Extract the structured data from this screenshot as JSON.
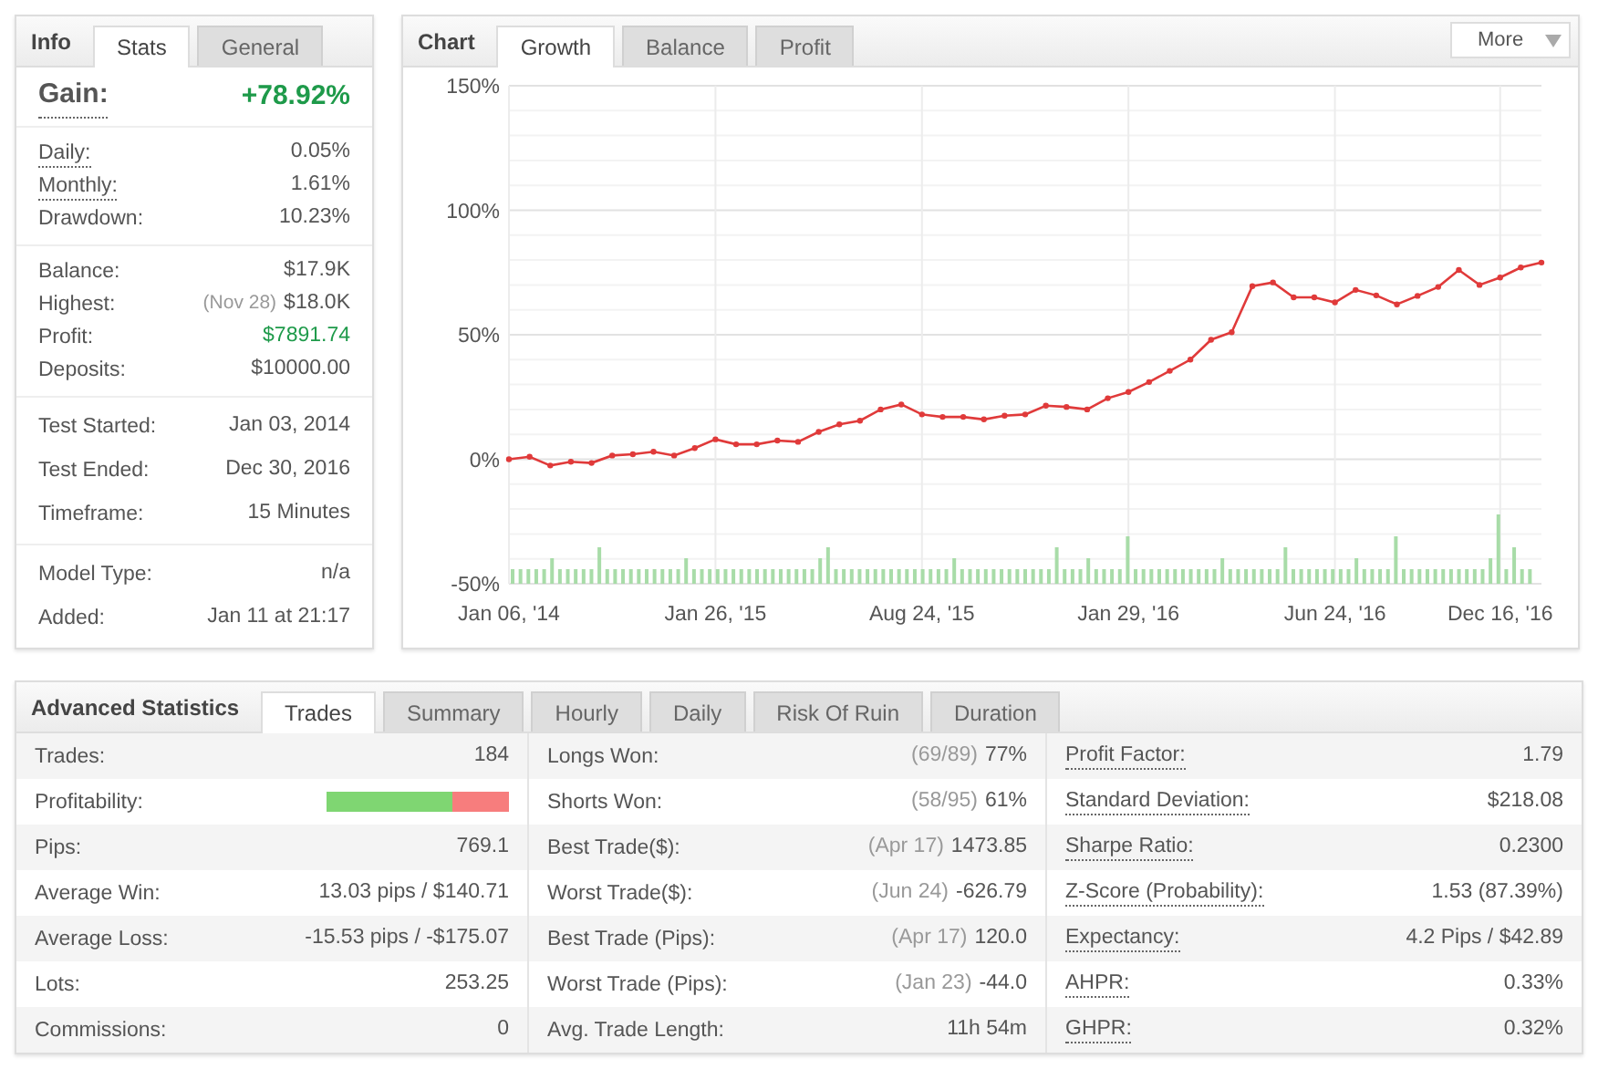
{
  "info": {
    "title": "Info",
    "tabs": [
      {
        "label": "Stats",
        "selected": true
      },
      {
        "label": "General",
        "selected": false
      }
    ],
    "gain": {
      "label": "Gain:",
      "value": "+78.92%",
      "positive": true,
      "has_tooltip": true
    },
    "groups": [
      [
        {
          "label": "Daily:",
          "value": "0.05%",
          "positive": false,
          "has_tooltip": true
        },
        {
          "label": "Monthly:",
          "value": "1.61%",
          "positive": false,
          "has_tooltip": true
        },
        {
          "label": "Drawdown:",
          "value": "10.23%",
          "positive": false,
          "has_tooltip": false
        }
      ],
      [
        {
          "label": "Balance:",
          "value": "$17.9K",
          "positive": false,
          "has_tooltip": false
        },
        {
          "label": "Highest:",
          "note": "(Nov 28)",
          "value": "$18.0K",
          "positive": false,
          "has_tooltip": false
        },
        {
          "label": "Profit:",
          "value": "$7891.74",
          "positive": true,
          "has_tooltip": false
        },
        {
          "label": "Deposits:",
          "value": "$10000.00",
          "positive": false,
          "has_tooltip": false
        }
      ],
      [
        {
          "label": "Test Started:",
          "value": "Jan 03, 2014",
          "positive": false,
          "has_tooltip": false
        },
        {
          "label": "Test Ended:",
          "value": "Dec 30, 2016",
          "positive": false,
          "has_tooltip": false
        },
        {
          "label": "Timeframe:",
          "value": "15 Minutes",
          "positive": false,
          "has_tooltip": false
        }
      ],
      [
        {
          "label": "Model Type:",
          "value": "n/a",
          "positive": false,
          "has_tooltip": false
        },
        {
          "label": "Added:",
          "value": "Jan 11 at 21:17",
          "positive": false,
          "has_tooltip": false
        }
      ]
    ]
  },
  "chart": {
    "title": "Chart",
    "tabs": [
      {
        "label": "Growth",
        "selected": true
      },
      {
        "label": "Balance",
        "selected": false
      },
      {
        "label": "Profit",
        "selected": false
      }
    ],
    "more_button": "More",
    "chart_data": {
      "type": "line",
      "ylim": [
        -50,
        150
      ],
      "yticks": [
        {
          "value": -50,
          "label": "-50%"
        },
        {
          "value": 0,
          "label": "0%"
        },
        {
          "value": 50,
          "label": "50%"
        },
        {
          "value": 100,
          "label": "100%"
        },
        {
          "value": 150,
          "label": "150%"
        }
      ],
      "grid": true,
      "categories": [
        "Jan 06, '14",
        null,
        null,
        null,
        null,
        null,
        null,
        null,
        null,
        null,
        "Jan 26, '15",
        null,
        null,
        null,
        null,
        null,
        null,
        null,
        null,
        null,
        "Aug 24, '15",
        null,
        null,
        null,
        null,
        null,
        null,
        null,
        null,
        null,
        "Jan 29, '16",
        null,
        null,
        null,
        null,
        null,
        null,
        null,
        null,
        null,
        "Jun 24, '16",
        null,
        null,
        null,
        null,
        null,
        null,
        null,
        "Dec 16, '16",
        null,
        null
      ],
      "series": [
        {
          "color": "#e03a3a",
          "marker": "o",
          "values": [
            0,
            1,
            -2.5,
            -1,
            -1.5,
            1.5,
            2,
            3,
            1.5,
            4.5,
            8,
            6,
            6,
            7.5,
            7,
            11,
            14,
            15.5,
            20,
            22,
            18,
            17,
            17,
            16,
            17.5,
            18,
            21.5,
            21,
            20,
            24.5,
            27,
            31,
            35.5,
            40,
            48,
            51,
            69.5,
            71,
            65,
            65,
            63,
            68,
            65.8,
            62.2,
            65.6,
            69.2,
            76,
            70,
            73,
            77,
            79
          ]
        }
      ]
    }
  },
  "advanced": {
    "title": "Advanced Statistics",
    "tabs": [
      {
        "label": "Trades",
        "selected": true
      },
      {
        "label": "Summary",
        "selected": false
      },
      {
        "label": "Hourly",
        "selected": false
      },
      {
        "label": "Daily",
        "selected": false
      },
      {
        "label": "Risk Of Ruin",
        "selected": false
      },
      {
        "label": "Duration",
        "selected": false
      }
    ],
    "columns": [
      [
        {
          "label": "Trades:",
          "value": "184",
          "kind": "text",
          "has_tooltip": false
        },
        {
          "label": "Profitability:",
          "kind": "bar",
          "level": 0.69,
          "has_tooltip": false
        },
        {
          "label": "Pips:",
          "value": "769.1",
          "kind": "text",
          "has_tooltip": false
        },
        {
          "label": "Average Win:",
          "value": "13.03 pips / $140.71",
          "kind": "text",
          "has_tooltip": false
        },
        {
          "label": "Average Loss:",
          "value": "-15.53 pips / -$175.07",
          "kind": "text",
          "has_tooltip": false
        },
        {
          "label": "Lots:",
          "value": "253.25",
          "kind": "text",
          "has_tooltip": false
        },
        {
          "label": "Commissions:",
          "value": "0",
          "kind": "text",
          "has_tooltip": false
        }
      ],
      [
        {
          "label": "Longs Won:",
          "note": "(69/89)",
          "value": "77%",
          "kind": "text",
          "has_tooltip": false
        },
        {
          "label": "Shorts Won:",
          "note": "(58/95)",
          "value": "61%",
          "kind": "text",
          "has_tooltip": false
        },
        {
          "label": "Best Trade($):",
          "note": "(Apr 17)",
          "value": "1473.85",
          "kind": "text",
          "has_tooltip": false
        },
        {
          "label": "Worst Trade($):",
          "note": "(Jun 24)",
          "value": "-626.79",
          "kind": "text",
          "has_tooltip": false
        },
        {
          "label": "Best Trade (Pips):",
          "note": "(Apr 17)",
          "value": "120.0",
          "kind": "text",
          "has_tooltip": false
        },
        {
          "label": "Worst Trade (Pips):",
          "note": "(Jan 23)",
          "value": "-44.0",
          "kind": "text",
          "has_tooltip": false
        },
        {
          "label": "Avg. Trade Length:",
          "value": "11h 54m",
          "kind": "text",
          "has_tooltip": false
        }
      ],
      [
        {
          "label": "Profit Factor:",
          "value": "1.79",
          "kind": "text",
          "has_tooltip": true
        },
        {
          "label": "Standard Deviation:",
          "value": "$218.08",
          "kind": "text",
          "has_tooltip": true
        },
        {
          "label": "Sharpe Ratio:",
          "value": "0.2300",
          "kind": "text",
          "has_tooltip": true
        },
        {
          "label": "Z-Score (Probability):",
          "value": "1.53 (87.39%)",
          "kind": "text",
          "has_tooltip": true
        },
        {
          "label": "Expectancy:",
          "value": "4.2 Pips / $42.89",
          "kind": "text",
          "has_tooltip": true
        },
        {
          "label": "AHPR:",
          "value": "0.33%",
          "kind": "text",
          "has_tooltip": true
        },
        {
          "label": "GHPR:",
          "value": "0.32%",
          "kind": "text",
          "has_tooltip": true
        }
      ]
    ]
  }
}
